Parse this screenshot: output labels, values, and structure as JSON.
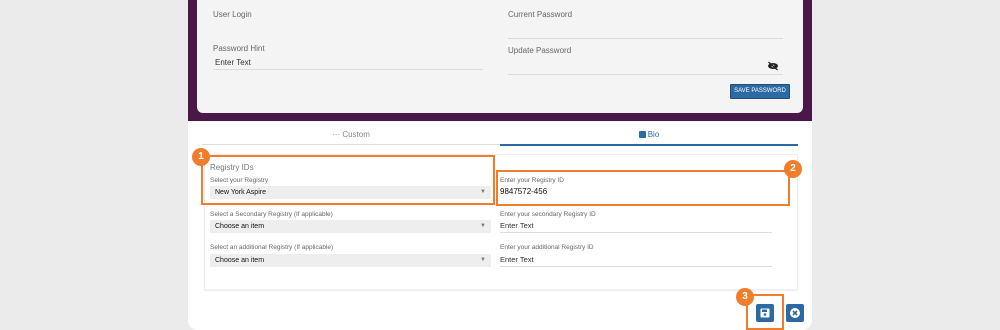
{
  "account": {
    "user_login_label": "User Login",
    "current_password_label": "Current Password",
    "password_hint_label": "Password Hint",
    "password_hint_value": "Enter Text",
    "update_password_label": "Update Password",
    "save_password_label": "SAVE PASSWORD"
  },
  "tabs": [
    {
      "label": "··· Custom"
    },
    {
      "label": "Bio"
    }
  ],
  "registry": {
    "section_title": "Registry IDs",
    "primary_label": "Select your Registry",
    "primary_value": "New York Aspire",
    "registry_id_label": "Enter your Registry ID",
    "registry_id_value": "9847572-456",
    "secondary_label": "Select a Secondary Registry (If applicable)",
    "secondary_value": "Choose an item",
    "secondary_id_label": "Enter your secondary Registry ID",
    "secondary_id_value": "Enter Text",
    "additional_label": "Select an additional Registry (If applicable)",
    "additional_value": "Choose an item",
    "additional_id_label": "Enter your additional Registry ID",
    "additional_id_value": "Enter Text"
  },
  "callouts": [
    "1",
    "2",
    "3"
  ],
  "colors": {
    "plum": "#4a1848",
    "accent": "#2c6aa3",
    "highlight": "#f07d2c"
  }
}
